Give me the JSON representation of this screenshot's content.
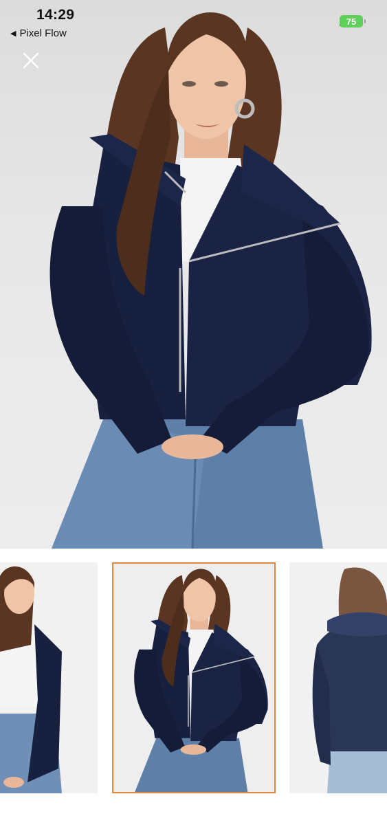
{
  "status_bar": {
    "time": "14:29",
    "back_label": "Pixel Flow",
    "battery": "75",
    "icons": [
      "cellular-signal-icon",
      "wifi-icon",
      "battery-icon"
    ]
  },
  "viewer": {
    "close_icon": "close-icon",
    "selected_thumbnail": 2,
    "thumbnail_count": 3,
    "colors": {
      "background": "#ffffff",
      "selected_border": "#e3873c",
      "battery_green": "#5fcf5b"
    }
  }
}
